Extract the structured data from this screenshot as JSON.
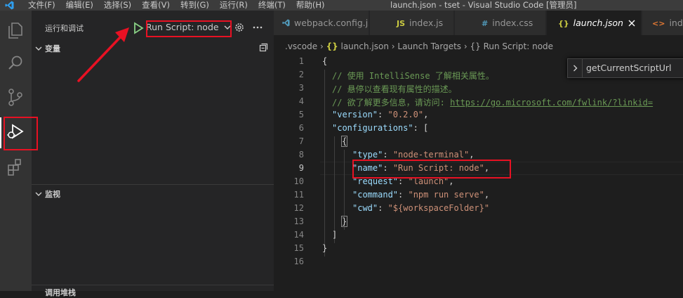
{
  "titlebar": {
    "menu": [
      "文件(F)",
      "编辑(E)",
      "选择(S)",
      "查看(V)",
      "转到(G)",
      "运行(R)",
      "终端(T)",
      "帮助(H)"
    ],
    "window_title": "launch.json - tset - Visual Studio Code [管理员]"
  },
  "sidebar": {
    "title": "运行和调试",
    "config_name": "Run Script: node",
    "sections": {
      "variables": "变量",
      "watch": "监视",
      "callstack": "调用堆栈"
    }
  },
  "tabs": [
    {
      "label": "webpack.config.js",
      "icon": "vscode-file-icon"
    },
    {
      "label": "index.js",
      "icon": "JS"
    },
    {
      "label": "index.css",
      "icon": "#"
    },
    {
      "label": "launch.json",
      "icon": "{}"
    },
    {
      "label": "inde",
      "icon": "<>"
    }
  ],
  "breadcrumbs": {
    "folder": ".vscode",
    "file": "launch.json",
    "section": "Launch Targets",
    "item": "Run Script: node"
  },
  "suggestion": "getCurrentScriptUrl",
  "code": {
    "line_numbers": [
      "1",
      "2",
      "3",
      "4",
      "5",
      "6",
      "7",
      "8",
      "9",
      "10",
      "11",
      "12",
      "13",
      "14",
      "15",
      "16"
    ],
    "comment1": "// 使用 IntelliSense 了解相关属性。",
    "comment2": "// 悬停以查看现有属性的描述。",
    "comment3_text": "// 欲了解更多信息，请访问: ",
    "comment3_url": "https://go.microsoft.com/fwlink/?linkid=",
    "version_key": "\"version\"",
    "version_val": "\"0.2.0\"",
    "configurations_key": "\"configurations\"",
    "type_key": "\"type\"",
    "type_val": "\"node-terminal\"",
    "name_key": "\"name\"",
    "name_val": "\"Run Script: node\"",
    "request_key": "\"request\"",
    "request_val": "\"launch\"",
    "command_key": "\"command\"",
    "command_val": "\"npm run serve\"",
    "cwd_key": "\"cwd\"",
    "cwd_val": "\"${workspaceFolder}\""
  },
  "colors": {
    "annotation": "#e81123",
    "accent": "#007acc",
    "run_green": "#89d185"
  }
}
